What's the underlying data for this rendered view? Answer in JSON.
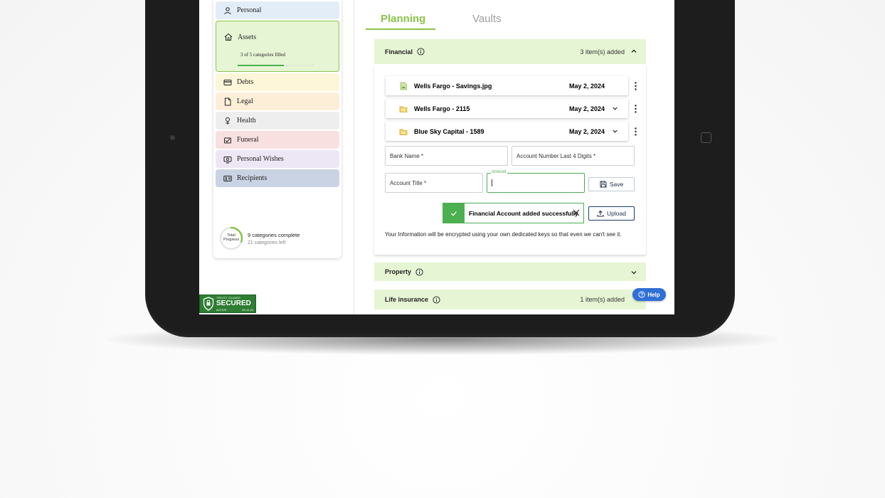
{
  "tabs": {
    "planning": "Planning",
    "vaults": "Vaults"
  },
  "sidebar": {
    "items": [
      {
        "label": "Personal",
        "icon": "person-icon",
        "color": "#e3edf7"
      },
      {
        "label": "Assets",
        "icon": "home-icon",
        "color": "#e6f5d4",
        "sub": "3 of 5 categories filled",
        "progress": 0.6
      },
      {
        "label": "Debts",
        "icon": "credit-card-icon",
        "color": "#fdf6d8"
      },
      {
        "label": "Legal",
        "icon": "document-icon",
        "color": "#fdeed8"
      },
      {
        "label": "Health",
        "icon": "health-icon",
        "color": "#eeeeee"
      },
      {
        "label": "Funeral",
        "icon": "funeral-icon",
        "color": "#f8e0e0"
      },
      {
        "label": "Personal Wishes",
        "icon": "wishes-icon",
        "color": "#ede6f5"
      },
      {
        "label": "Recipients",
        "icon": "recipients-icon",
        "color": "#c9d3e3"
      }
    ],
    "progress": {
      "ring_label_1": "Total",
      "ring_label_2": "Progress",
      "complete": "9 categories complete",
      "left": "21 categories left",
      "fraction": 0.3
    }
  },
  "trust_badge": {
    "line1": "TRUST GUARD",
    "line2": "SECURED",
    "line3a": "ACTIVE",
    "line3b": "05-11-24"
  },
  "financial": {
    "title": "Financial",
    "count": "3 item(s) added",
    "files": [
      {
        "name": "Wells Fargo - Savings.jpg",
        "date": "May 2, 2024",
        "icon": "image-file-icon"
      },
      {
        "name": "Wells Fargo - 2115",
        "date": "May 2, 2024",
        "icon": "folder-icon"
      },
      {
        "name": "Blue Sky Capital - 1589",
        "date": "May 2, 2024",
        "icon": "folder-icon"
      }
    ],
    "bank_name": "Bank Name *",
    "account_number": "Account Number Last 4 Digits *",
    "account_title": "Account Title *",
    "amount_label": "Amount",
    "amount_value": "",
    "save": "Save",
    "upload": "Upload",
    "toast": "Financial Account added successfully",
    "note": "Your Information will be encrypted using your own dedicated keys so that even we can't see it."
  },
  "property": {
    "title": "Property"
  },
  "life_insurance": {
    "title": "Life insurance",
    "count": "1 item(s) added"
  },
  "help": "Help",
  "colors": {
    "accent": "#8bc34a",
    "success": "#4caf50",
    "accordion_bg": "#e6f5d4",
    "help_blue": "#2f6fd6"
  }
}
